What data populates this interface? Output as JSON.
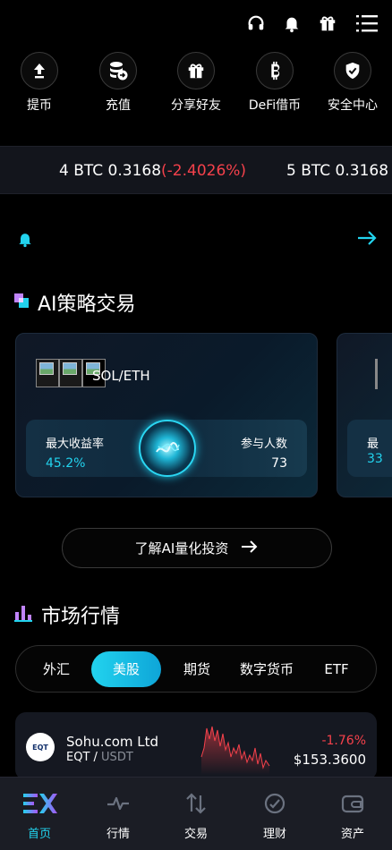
{
  "quick_actions": [
    {
      "label": "提币",
      "icon": "withdraw-icon"
    },
    {
      "label": "充值",
      "icon": "deposit-icon"
    },
    {
      "label": "分享好友",
      "icon": "gift-icon"
    },
    {
      "label": "DeFi借币",
      "icon": "bitcoin-icon"
    },
    {
      "label": "安全中心",
      "icon": "shield-icon"
    }
  ],
  "ticker": {
    "items": [
      {
        "text": "4 BTC 0.3168",
        "change": "(-2.4026%)"
      },
      {
        "text": "5 BTC 0.3168",
        "change": ""
      }
    ]
  },
  "ai_section": {
    "title": "AI策略交易",
    "card": {
      "pair": "SOL/ETH",
      "max_yield_label": "最大收益率",
      "max_yield_value": "45.2%",
      "participants_label": "参与人数",
      "participants_value": "73"
    },
    "peek_card": {
      "label_partial": "最",
      "value_partial": "33"
    },
    "learn_button": "了解AI量化投资"
  },
  "market_section": {
    "title": "市场行情",
    "tabs": [
      "外汇",
      "美股",
      "期货",
      "数字货币",
      "ETF"
    ],
    "active_tab": 1,
    "rows": [
      {
        "name": "Sohu.com Ltd",
        "symbol": "EQT",
        "quote": "USDT",
        "avatar_text": "EQT",
        "change": "-1.76%",
        "price": "$153.3600"
      }
    ]
  },
  "bottom_nav": [
    {
      "label": "首页",
      "icon": "home-logo-icon",
      "active": true
    },
    {
      "label": "行情",
      "icon": "pulse-icon",
      "active": false
    },
    {
      "label": "交易",
      "icon": "swap-icon",
      "active": false
    },
    {
      "label": "理财",
      "icon": "finance-icon",
      "active": false
    },
    {
      "label": "资产",
      "icon": "wallet-icon",
      "active": false
    }
  ],
  "colors": {
    "accent": "#22d3ee",
    "negative": "#f5414b",
    "background": "#000000",
    "nav_background": "#1b1d25"
  }
}
